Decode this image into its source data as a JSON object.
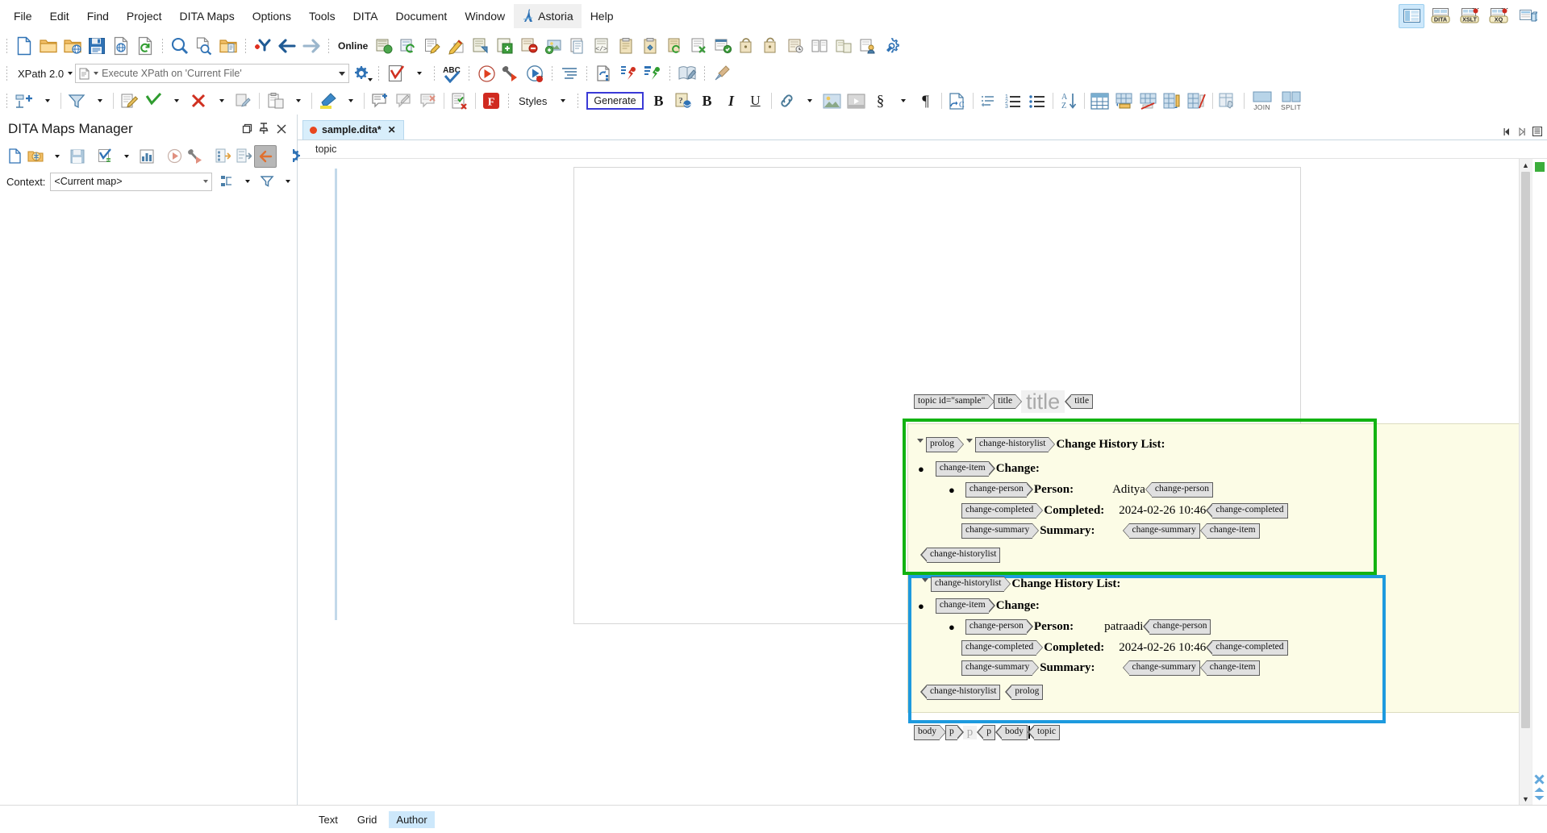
{
  "app": {
    "title": "Oxygen XML Editor",
    "menu": [
      "File",
      "Edit",
      "Find",
      "Project",
      "DITA Maps",
      "Options",
      "Tools",
      "DITA",
      "Document",
      "Window",
      "Astoria",
      "Help"
    ],
    "menu_right_icons": [
      "layout-panel-icon",
      "dita-transform-icon",
      "xslt-debugger-icon",
      "xquery-debugger-icon",
      "database-explorer-icon"
    ]
  },
  "toolbar_row1": {
    "items": [
      {
        "name": "new-file-icon",
        "tip": "New"
      },
      {
        "name": "open-folder-icon",
        "tip": "Open"
      },
      {
        "name": "open-url-icon",
        "tip": "Open URL"
      },
      {
        "name": "save-icon",
        "tip": "Save"
      },
      {
        "name": "save-remote-icon",
        "tip": "Save remote"
      },
      {
        "name": "reload-icon",
        "tip": "Reload"
      },
      {
        "name": "find-icon",
        "tip": "Find/Replace"
      },
      {
        "name": "find-in-files-icon",
        "tip": "Find in Files"
      },
      {
        "name": "open-in-folder-icon",
        "tip": "Open folder"
      },
      {
        "name": "go-to-matching-icon",
        "tip": "Go to"
      },
      {
        "name": "back-arrow-icon",
        "tip": "Back"
      },
      {
        "name": "forward-arrow-icon",
        "tip": "Forward"
      }
    ],
    "online_label": "Online",
    "astoria_icons": [
      "astoria-checkout-icon",
      "astoria-checkin-icon",
      "astoria-edit-icon",
      "astoria-pencil-icon",
      "astoria-select-icon",
      "astoria-export-icon",
      "astoria-cancel-icon",
      "astoria-add-image-icon",
      "astoria-properties-icon",
      "astoria-source-icon",
      "astoria-clipboard-icon",
      "astoria-clipboard-link-icon",
      "astoria-clipboard-refresh-icon",
      "astoria-delete-icon",
      "astoria-calendar-icon",
      "astoria-lock-icon",
      "astoria-unlock-icon",
      "astoria-history-icon",
      "astoria-compare-icon",
      "astoria-branch-icon",
      "astoria-user-icon",
      "astoria-settings-icon"
    ]
  },
  "toolbar_row2": {
    "xpath_version": "XPath 2.0",
    "xpath_placeholder": "Execute XPath on  'Current File'",
    "xpath_value": "",
    "items": [
      {
        "name": "validate-icon",
        "tip": "Validate"
      },
      {
        "name": "spell-check-icon",
        "tip": "Check Spelling"
      },
      {
        "name": "transform-icon",
        "tip": "Apply Transformation Scenario"
      },
      {
        "name": "configure-transform-icon",
        "tip": "Configure Transformation Scenario"
      },
      {
        "name": "debug-transform-icon",
        "tip": "Debug Scenario"
      },
      {
        "name": "format-indent-icon",
        "tip": "Format and Indent"
      },
      {
        "name": "xml-refactor-icon",
        "tip": "XML Refactoring"
      },
      {
        "name": "add-bookmark-red-icon",
        "tip": "Bookmark"
      },
      {
        "name": "add-bookmark-green-icon",
        "tip": "Bookmark"
      },
      {
        "name": "edit-reference-icon",
        "tip": "Edit reference"
      },
      {
        "name": "broom-icon",
        "tip": "Clean"
      }
    ]
  },
  "toolbar_row3": {
    "styles_label": "Styles",
    "generate_label": "Generate",
    "items_left": [
      {
        "name": "insert-section-icon"
      },
      {
        "name": "filter-icon"
      },
      {
        "name": "track-changes-icon"
      },
      {
        "name": "accept-change-icon"
      },
      {
        "name": "reject-change-icon"
      },
      {
        "name": "copy-change-icon"
      },
      {
        "name": "paste-special-icon"
      },
      {
        "name": "highlight-icon"
      },
      {
        "name": "add-comment-icon"
      },
      {
        "name": "edit-comment-icon"
      },
      {
        "name": "remove-comment-icon"
      },
      {
        "name": "manage-comments-icon"
      },
      {
        "name": "framemaker-icon"
      }
    ],
    "items_right": [
      {
        "name": "bold-icon",
        "glyph": "B"
      },
      {
        "name": "help-bold-icon"
      },
      {
        "name": "strong-icon",
        "glyph": "B"
      },
      {
        "name": "italic-icon",
        "glyph": "I"
      },
      {
        "name": "underline-icon",
        "glyph": "U"
      },
      {
        "name": "link-icon"
      },
      {
        "name": "insert-image-icon"
      },
      {
        "name": "insert-media-icon"
      },
      {
        "name": "section-symbol-icon",
        "glyph": "§"
      },
      {
        "name": "paragraph-mark-icon",
        "glyph": "¶"
      },
      {
        "name": "insert-codeblock-icon"
      },
      {
        "name": "definition-list-icon"
      },
      {
        "name": "ordered-list-icon"
      },
      {
        "name": "unordered-list-icon"
      },
      {
        "name": "sort-az-icon"
      },
      {
        "name": "insert-table-icon"
      },
      {
        "name": "insert-row-above-icon"
      },
      {
        "name": "delete-row-icon"
      },
      {
        "name": "insert-column-icon"
      },
      {
        "name": "delete-column-icon"
      },
      {
        "name": "table-properties-icon"
      }
    ],
    "join_label": "JOIN",
    "split_label": "SPLIT"
  },
  "sidebar": {
    "title": "DITA Maps Manager",
    "window_buttons": [
      "maximize-icon",
      "pin-icon",
      "close-icon"
    ],
    "toolbar_icons": [
      "new-map-icon",
      "open-map-icon",
      "save-map-icon",
      "validate-map-icon",
      "statistics-icon",
      "transform-map-icon",
      "configure-map-icon",
      "expand-refs-icon",
      "collapse-refs-icon",
      "link-back-icon",
      "map-settings-icon"
    ],
    "context_label": "Context:",
    "context_value": "<Current map>",
    "context_buttons": [
      "hierarchy-icon",
      "filter-icon"
    ]
  },
  "editor": {
    "tab": {
      "filename": "sample.dita*",
      "modified": true,
      "close_label": "✕"
    },
    "tab_nav": [
      "prev-tab-icon",
      "next-tab-icon",
      "tab-list-icon"
    ],
    "breadcrumb": "topic",
    "view_tabs": [
      {
        "label": "Text",
        "active": false
      },
      {
        "label": "Grid",
        "active": false
      },
      {
        "label": "Author",
        "active": true
      }
    ]
  },
  "document": {
    "header_line": {
      "tags": [
        "topic id=\"sample\"",
        "title"
      ],
      "placeholder": "title",
      "close_tag": "title"
    },
    "green_block": {
      "highlight_color": "#12b312",
      "fold_markers": 2,
      "open_tags": [
        "prolog",
        "change-historylist"
      ],
      "heading": "Change History List:",
      "item": {
        "tag": "change-item",
        "label": "Change:",
        "fields": [
          {
            "tag": "change-person",
            "label": "Person:",
            "value": "Aditya",
            "close_tag": "change-person",
            "bulleted": true
          },
          {
            "tag": "change-completed",
            "label": "Completed:",
            "value": "2024-02-26 10:46",
            "close_tag": "change-completed",
            "bulleted": false
          },
          {
            "tag": "change-summary",
            "label": "Summary:",
            "value": "",
            "close_tag": "change-summary",
            "extra_close": "change-item",
            "bulleted": false
          }
        ]
      },
      "close_tags": [
        "change-historylist"
      ]
    },
    "blue_block": {
      "highlight_color": "#1d9ade",
      "fold_markers": 1,
      "open_tags": [
        "change-historylist"
      ],
      "heading": "Change History List:",
      "item": {
        "tag": "change-item",
        "label": "Change:",
        "fields": [
          {
            "tag": "change-person",
            "label": "Person:",
            "value": "patraadi",
            "close_tag": "change-person",
            "bulleted": true
          },
          {
            "tag": "change-completed",
            "label": "Completed:",
            "value": "2024-02-26 10:46",
            "close_tag": "change-completed",
            "bulleted": false
          },
          {
            "tag": "change-summary",
            "label": "Summary:",
            "value": "",
            "close_tag": "change-summary",
            "extra_close": "change-item",
            "bulleted": false
          }
        ]
      },
      "close_tags": [
        "change-historylist",
        "prolog"
      ]
    },
    "footer_line": {
      "open_tags": [
        "body",
        "p"
      ],
      "placeholder": "p",
      "close_tags": [
        "p",
        "body",
        "topic"
      ]
    }
  }
}
